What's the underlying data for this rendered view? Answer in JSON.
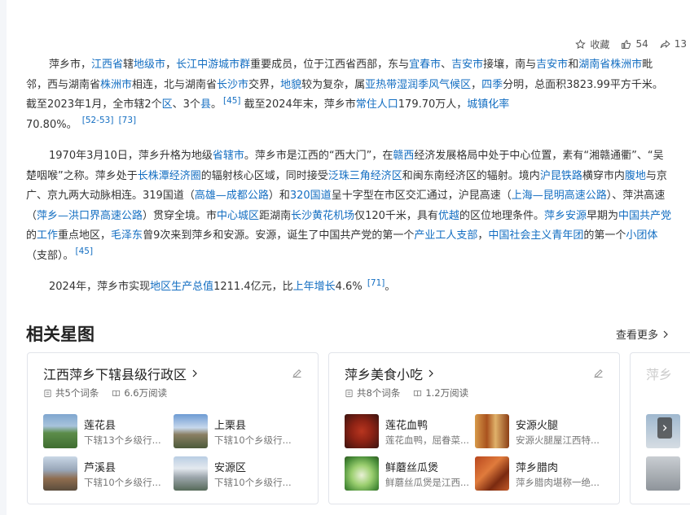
{
  "toolbar": {
    "collect_label": "收藏",
    "like_count": "54",
    "share_count": "13"
  },
  "article": {
    "p1": [
      "萍乡市，",
      "江西省",
      "辖",
      "地级市",
      "，",
      "长江中游城市群",
      "重要成员，位于江西省西部，东与",
      "宜春市",
      "、",
      "吉安市",
      "接壤，南与",
      "吉安市",
      "和",
      "湖南省",
      "株洲市",
      "毗邻，西与湖南省",
      "株洲市",
      "相连，北与湖南省",
      "长沙市",
      "交界，",
      "地貌",
      "较为复杂，属",
      "亚热带湿润季风气候区",
      "，",
      "四季",
      "分明，总面积3823.99平方千米。截至2023年1月，全市辖2个",
      "区",
      "、3个",
      "县",
      "。",
      "[45]",
      "截至2024年末，萍乡市",
      "常住人口",
      "179.70万人，",
      "城镇化率",
      "70.80%。",
      "[52-53]",
      "[73]"
    ],
    "p2": [
      "1970年3月10日，萍乡升格为地级",
      "省辖市",
      "。萍乡市是江西的“西大门”，在",
      "赣西",
      "经济发展格局中处于中心位置，素有“湘赣通衢”、“吴楚咽喉”之称。萍乡处于",
      "长株潭经济圈",
      "的辐射核心区域，同时接受",
      "泛珠三角经济区",
      "和闽东南经济区的辐射。境内",
      "沪昆铁路",
      "横穿市内",
      "腹地",
      "与京广、京九两大动脉相连。319国道（",
      "高雄—成都公路",
      "）和",
      "320国道",
      "呈十字型在市区交汇通过，沪昆高速（",
      "上海—昆明高速公路",
      "）、萍洪高速（",
      "萍乡—洪口界高速公路",
      "）贯穿全境。市",
      "中心城区",
      "距湖南",
      "长沙黄花机场",
      "仅120千米，具有",
      "优越",
      "的区位地理条件。",
      "萍乡安源",
      "早期为",
      "中国共产党",
      "的",
      "工作",
      "重点地区，",
      "毛泽东",
      "曾9次来到萍乡和安源。安源，诞生了中国共产党的第一个",
      "产业工人支部",
      "，",
      "中国社会主义青年团",
      "的第一个",
      "小团体",
      "（支部）。",
      "[45]"
    ],
    "p3": [
      "2024年，萍乡市实现",
      "地区生产总值",
      "1211.4亿元，比",
      "上年",
      "增长",
      "4.6%",
      "[71]",
      "。"
    ]
  },
  "section": {
    "title": "相关星图",
    "more": "查看更多"
  },
  "cards": [
    {
      "title": "江西萍乡下辖县级行政区",
      "count": "共5个词条",
      "reads": "6.6万阅读",
      "entries": [
        {
          "name": "莲花县",
          "desc": "下辖13个乡级行..."
        },
        {
          "name": "上栗县",
          "desc": "下辖10个乡级行..."
        },
        {
          "name": "芦溪县",
          "desc": "下辖10个乡级行..."
        },
        {
          "name": "安源区",
          "desc": "下辖10个乡级行..."
        }
      ]
    },
    {
      "title": "萍乡美食小吃",
      "count": "共8个词条",
      "reads": "1.2万阅读",
      "entries": [
        {
          "name": "莲花血鸭",
          "desc": "莲花血鸭，屈眷菜..."
        },
        {
          "name": "安源火腿",
          "desc": "安源火腿屋江西特..."
        },
        {
          "name": "鲜蘑丝瓜煲",
          "desc": "鲜蘑丝瓜煲是江西..."
        },
        {
          "name": "萍乡腊肉",
          "desc": "萍乡腊肉堪称一绝..."
        }
      ]
    }
  ],
  "card3": {
    "title": "萍乡"
  },
  "colors": {
    "link": "#136ec2",
    "text": "#333333",
    "border": "#e1e4ea"
  }
}
